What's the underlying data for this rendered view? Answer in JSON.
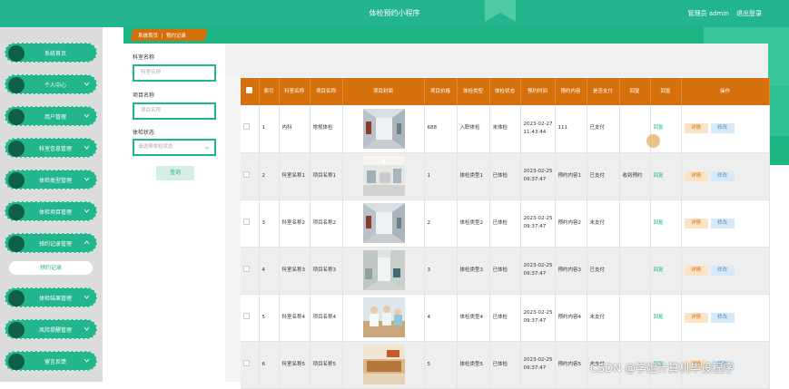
{
  "header": {
    "title": "体检预约小程序",
    "user_role": "管理员 admin",
    "logout": "退出登录"
  },
  "sidebar": {
    "items": [
      {
        "label": "系统首页",
        "expandable": false
      },
      {
        "label": "个人中心",
        "expandable": true
      },
      {
        "label": "用户管理",
        "expandable": true
      },
      {
        "label": "科室信息管理",
        "expandable": true
      },
      {
        "label": "体检类型管理",
        "expandable": true
      },
      {
        "label": "体检项目管理",
        "expandable": true
      },
      {
        "label": "预约记录管理",
        "expandable": true,
        "expanded": true
      },
      {
        "label": "体检结果管理",
        "expandable": true
      },
      {
        "label": "风险提醒管理",
        "expandable": true
      },
      {
        "label": "留言反馈",
        "expandable": true
      }
    ],
    "sub_item": "预约记录"
  },
  "breadcrumb": {
    "home": "系统首页",
    "current": "预约记录"
  },
  "filter": {
    "dept_label": "科室名称",
    "dept_placeholder": "科室名称",
    "item_label": "项目名称",
    "item_placeholder": "项目名称",
    "status_label": "体检状态",
    "status_placeholder": "请选择体检状态",
    "search_button": "查询"
  },
  "table": {
    "headers": [
      "",
      "索引",
      "科室名称",
      "项目名称",
      "项目封面",
      "项目价格",
      "体检类型",
      "体检状态",
      "预约时间",
      "预约内容",
      "是否支付",
      "回复",
      "回复",
      "操作"
    ],
    "rows": [
      {
        "index": "1",
        "dept": "内科",
        "item": "常规体检",
        "price": "688",
        "type": "入职体检",
        "status": "未体检",
        "time": "2023-02-27 11:43:44",
        "content": "111",
        "paid": "已支付",
        "reply_text": "",
        "reply_link": "回复",
        "thumb": "hallway"
      },
      {
        "index": "2",
        "dept": "科室名称1",
        "item": "项目名称1",
        "price": "1",
        "type": "体检类型1",
        "status": "已体检",
        "time": "2023-02-25 09:37:47",
        "content": "预约内容1",
        "paid": "已支付",
        "reply_text": "收到预约",
        "reply_link": "回复",
        "thumb": "lobby"
      },
      {
        "index": "3",
        "dept": "科室名称2",
        "item": "项目名称2",
        "price": "2",
        "type": "体检类型2",
        "status": "已体检",
        "time": "2023-02-25 09:37:47",
        "content": "预约内容2",
        "paid": "未支付",
        "reply_text": "",
        "reply_link": "回复",
        "thumb": "hallway"
      },
      {
        "index": "4",
        "dept": "科室名称3",
        "item": "项目名称3",
        "price": "3",
        "type": "体检类型3",
        "status": "已体检",
        "time": "2023-02-25 09:37:47",
        "content": "预约内容3",
        "paid": "已支付",
        "reply_text": "",
        "reply_link": "回复",
        "thumb": "corridor"
      },
      {
        "index": "5",
        "dept": "科室名称4",
        "item": "项目名称4",
        "price": "4",
        "type": "体检类型4",
        "status": "已体检",
        "time": "2023-02-25 09:37:47",
        "content": "预约内容4",
        "paid": "未支付",
        "reply_text": "",
        "reply_link": "回复",
        "thumb": "nurses"
      },
      {
        "index": "6",
        "dept": "科室名称5",
        "item": "项目名称5",
        "price": "5",
        "type": "体检类型5",
        "status": "已体检",
        "time": "2023-02-25 09:37:47",
        "content": "预约内容5",
        "paid": "未支付",
        "reply_text": "",
        "reply_link": "回复",
        "thumb": "reception"
      }
    ],
    "detail_button": "详情",
    "edit_button": "修改"
  },
  "watermark": "CSDN @学姐计算机毕设程序",
  "colors": {
    "primary": "#23b58c",
    "header_orange": "#d5700c",
    "detail_bg": "#fbe3c6",
    "edit_bg": "#d6e9f6"
  }
}
